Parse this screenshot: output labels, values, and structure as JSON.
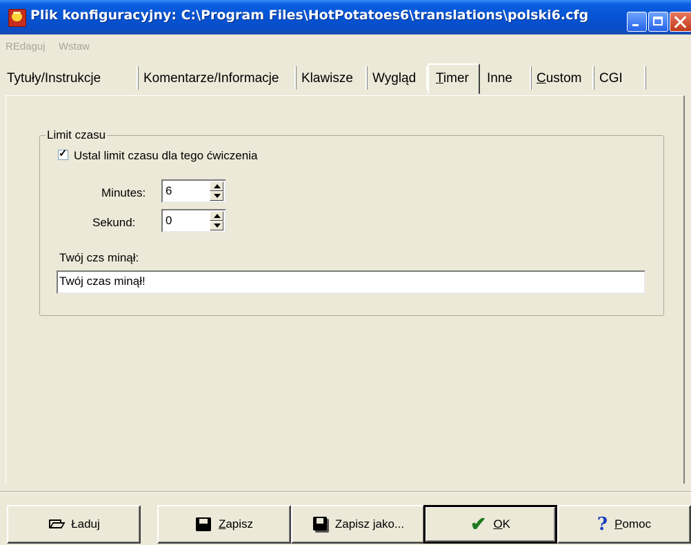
{
  "window": {
    "title": "Plik konfiguracyjny: C:\\Program Files\\HotPotatoes6\\translations\\polski6.cfg",
    "icon": "hot-potatoes-app-icon",
    "controls": [
      "minimize-icon",
      "maximize-icon",
      "close-icon"
    ]
  },
  "menu": {
    "items": [
      {
        "label": "REdaguj",
        "enabled": false
      },
      {
        "label": "Wstaw",
        "enabled": false
      }
    ]
  },
  "tabs": [
    {
      "label": "Tytuły/Instrukcje",
      "active": false
    },
    {
      "label": "Komentarze/Informacje",
      "active": false
    },
    {
      "label": "Klawisze",
      "active": false
    },
    {
      "label": "Wygląd",
      "active": false
    },
    {
      "label": "Timer",
      "active": true,
      "mnemonic": "T"
    },
    {
      "label": "Inne",
      "active": false
    },
    {
      "label": "Custom",
      "active": false,
      "mnemonic": "C"
    },
    {
      "label": "CGI",
      "active": false
    }
  ],
  "timer": {
    "group_title": "Limit czasu",
    "enable_label": "Ustal limit czasu dla tego ćwiczenia",
    "enable_checked": true,
    "minutes_label": "Minutes:",
    "minutes_value": "6",
    "seconds_label": "Sekund:",
    "seconds_value": "0",
    "message_label": "Twój czs minął:",
    "message_value": "Twój czas minął!"
  },
  "buttons": {
    "load": {
      "label": "Ładuj",
      "icon": "folder-open-icon"
    },
    "save": {
      "mnemonic": "Z",
      "rest": "apisz",
      "icon": "floppy-disk-icon"
    },
    "save_as": {
      "before": "Zapisz ",
      "mnemonic": "j",
      "after": "ako...",
      "icon": "multiple-disks-icon"
    },
    "ok": {
      "mnemonic": "O",
      "rest": "K",
      "icon": "green-check-icon"
    },
    "help": {
      "mnemonic": "P",
      "rest": "omoc",
      "icon": "question-mark-icon"
    }
  },
  "colors": {
    "titlebar": "#0553d4",
    "face": "#ece9d8",
    "close": "#c1391a",
    "ok_check": "#1e7a1e",
    "help_mark": "#1a3fbf"
  }
}
